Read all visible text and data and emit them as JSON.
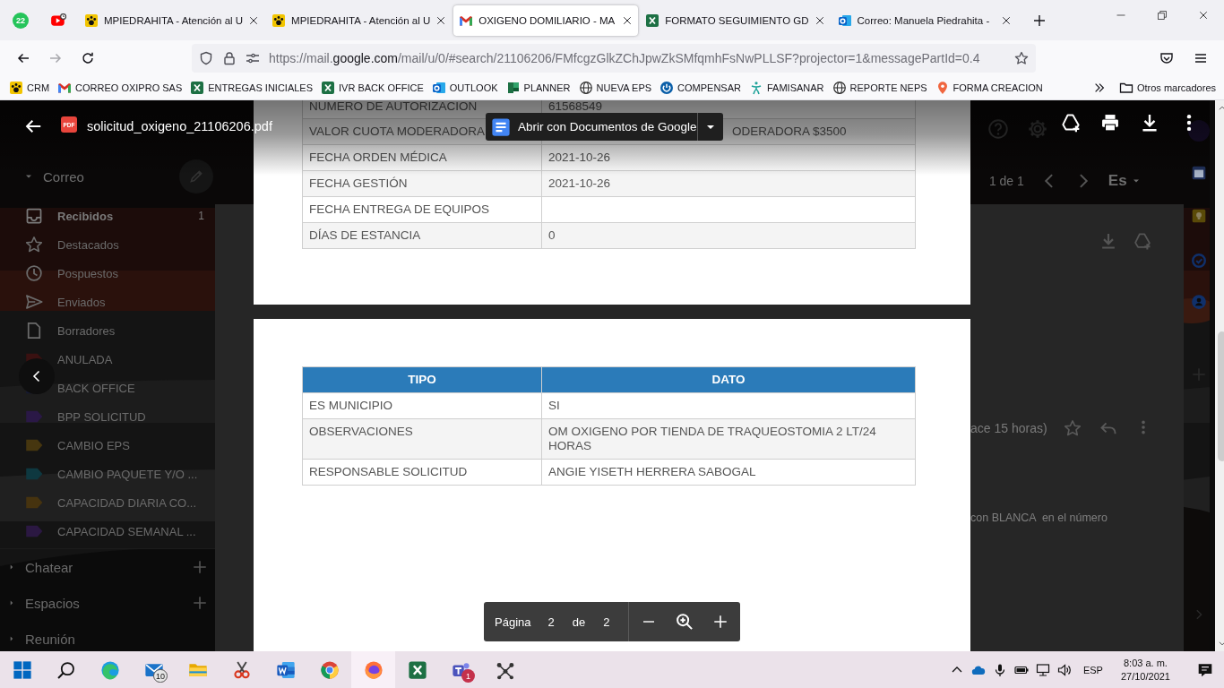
{
  "browser": {
    "pinned_tabs": [
      {
        "kind": "whatsapp",
        "badge": "22",
        "selected": false
      },
      {
        "kind": "youtube",
        "selected": false
      }
    ],
    "tabs": [
      {
        "kind": "paw",
        "title": "MPIEDRAHITA - Atención al U",
        "selected": false
      },
      {
        "kind": "paw",
        "title": "MPIEDRAHITA - Atención al U",
        "selected": false
      },
      {
        "kind": "mail",
        "title": "OXIGENO DOMILIARIO - MA",
        "selected": true
      },
      {
        "kind": "excel",
        "title": "FORMATO SEGUIMIENTO GD",
        "selected": false
      },
      {
        "kind": "outlook",
        "title": "Correo: Manuela Piedrahita -",
        "selected": false
      }
    ],
    "address": {
      "prefix": "https://mail.",
      "domain": "google.com",
      "rest": "/mail/u/0/#search/21106206/FMfcgzGlkZChJpwZkSMfqmhFsNwPLLSF?projector=1&messagePartId=0.4"
    },
    "bookmarks": [
      {
        "kind": "paw",
        "label": "CRM"
      },
      {
        "kind": "mail",
        "label": "CORREO OXIPRO SAS"
      },
      {
        "kind": "excel",
        "label": "ENTREGAS INICIALES"
      },
      {
        "kind": "excel",
        "label": "IVR BACK OFFICE"
      },
      {
        "kind": "outlook",
        "label": "OUTLOOK"
      },
      {
        "kind": "planner",
        "label": "PLANNER"
      },
      {
        "kind": "globe",
        "label": "NUEVA EPS"
      },
      {
        "kind": "power",
        "label": "COMPENSAR"
      },
      {
        "kind": "figure",
        "label": "FAMISANAR"
      },
      {
        "kind": "globe",
        "label": "REPORTE NEPS"
      },
      {
        "kind": "pin",
        "label": "FORMA CREACION"
      }
    ],
    "other_bookmarks": "Otros marcadores"
  },
  "gmail": {
    "section": "Correo",
    "folders": [
      {
        "kind": "inbox",
        "label": "Recibidos",
        "count": "1",
        "unread": true
      },
      {
        "kind": "star",
        "label": "Destacados",
        "unread": false
      },
      {
        "kind": "clock",
        "label": "Pospuestos",
        "unread": false
      },
      {
        "kind": "send",
        "label": "Enviados",
        "unread": false
      },
      {
        "kind": "file",
        "label": "Borradores",
        "unread": false
      }
    ],
    "labels": [
      {
        "label": "ANULADA",
        "color": "#3a1111"
      },
      {
        "label": "BACK OFFICE",
        "color": "#161a33"
      },
      {
        "label": "BPP SOLICITUD",
        "color": "#2a1846"
      },
      {
        "label": "CAMBIO EPS",
        "color": "#46360f"
      },
      {
        "label": "CAMBIO PAQUETE Y/O ...",
        "color": "#0e3840"
      },
      {
        "label": "CAPACIDAD DIARIA CO...",
        "color": "#46330f"
      },
      {
        "label": "CAPACIDAD SEMANAL ...",
        "color": "#2b1842"
      }
    ],
    "sections": [
      {
        "label": "Chatear",
        "addable": true
      },
      {
        "label": "Espacios",
        "addable": true
      },
      {
        "label": "Reunión",
        "addable": false
      }
    ],
    "pagination": "1 de 1",
    "language": "Es",
    "message_time": "ace 15 horas)",
    "message_snippet": "con BLANCA  en el número"
  },
  "viewer": {
    "file_badge": "PDF",
    "file_name": "solicitud_oxigeno_21106206.pdf",
    "open_with": "Abrir con Documentos de Google",
    "pages": [
      {
        "rows": [
          {
            "field": "NUMERO DE AUTORIZACION",
            "value": "61568549"
          },
          {
            "field": "VALOR CUOTA MODERADORA",
            "value": "ODERADORA $3500",
            "covered": true
          },
          {
            "field": "FECHA ORDEN MÉDICA",
            "value": "2021-10-26"
          },
          {
            "field": "FECHA GESTIÓN",
            "value": "2021-10-26"
          },
          {
            "field": "FECHA ENTREGA DE EQUIPOS"
          },
          {
            "field": "DÍAS DE ESTANCIA",
            "value": "0"
          }
        ]
      },
      {
        "columns": [
          "TIPO",
          "DATO"
        ],
        "rows": [
          {
            "field": "ES MUNICIPIO",
            "value": "SI"
          },
          {
            "field": "OBSERVACIONES",
            "value": "OM OXIGENO POR TIENDA DE TRAQUEOSTOMIA 2 LT/24 HORAS"
          },
          {
            "field": "RESPONSABLE SOLICITUD",
            "value": "ANGIE YISETH HERRERA SABOGAL"
          }
        ]
      }
    ],
    "pager": {
      "label": "Página",
      "current": "2",
      "of": "de",
      "total": "2"
    }
  },
  "taskbar": {
    "apps": [
      {
        "kind": "start",
        "selected": false
      },
      {
        "kind": "search",
        "selected": false
      },
      {
        "kind": "edge",
        "selected": false
      },
      {
        "kind": "mail",
        "badge": "10",
        "selected": false
      },
      {
        "kind": "explorer",
        "selected": false
      },
      {
        "kind": "snip",
        "selected": false
      },
      {
        "kind": "word",
        "selected": false
      },
      {
        "kind": "chrome",
        "selected": false
      },
      {
        "kind": "firefox",
        "selected": true
      },
      {
        "kind": "excel",
        "selected": false
      },
      {
        "kind": "teams",
        "badge": "1",
        "selected": false
      },
      {
        "kind": "network",
        "selected": false
      }
    ],
    "language": "ESP",
    "time": "8:03 a. m.",
    "date": "27/10/2021"
  }
}
